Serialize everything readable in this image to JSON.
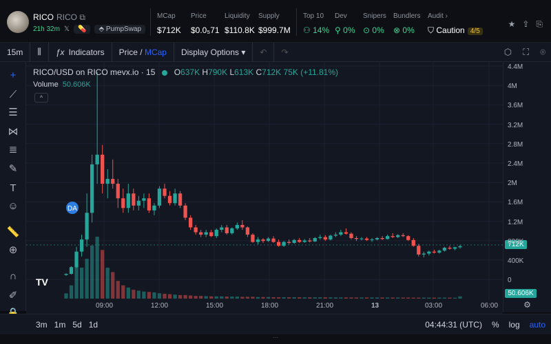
{
  "token": {
    "name": "RICO",
    "symbol": "RICO",
    "age": "21h 32m",
    "dex": "PumpSwap"
  },
  "stats": [
    {
      "label": "MCap",
      "value": "$712K"
    },
    {
      "label": "Price",
      "value": "$0.0₅71"
    },
    {
      "label": "Liquidity",
      "value": "$110.8K"
    },
    {
      "label": "Supply",
      "value": "$999.7M"
    }
  ],
  "holders": [
    {
      "label": "Top 10",
      "value": "14%"
    },
    {
      "label": "Dev",
      "value": "0%"
    },
    {
      "label": "Snipers",
      "value": "0%"
    },
    {
      "label": "Bundlers",
      "value": "0%"
    }
  ],
  "audit": {
    "label": "Audit",
    "value": "Caution",
    "score": "4/5"
  },
  "toolbar": {
    "interval": "15m",
    "indicators": "Indicators",
    "price": "Price",
    "mcap": "MCap",
    "display": "Display Options"
  },
  "legend": {
    "pair": "RICO/USD on RICO mevx.io · 15",
    "o": "637K",
    "h": "790K",
    "l": "613K",
    "c": "712K",
    "change": "75K (+11.81%)",
    "volume_label": "Volume",
    "volume_value": "50.606K"
  },
  "yaxis": [
    "4.4M",
    "4M",
    "3.6M",
    "3.2M",
    "2.8M",
    "2.4M",
    "2M",
    "1.6M",
    "1.2M",
    "800K",
    "400K",
    "0"
  ],
  "price_tag": "712K",
  "volume_tag": "50.606K",
  "xaxis": [
    "09:00",
    "12:00",
    "15:00",
    "18:00",
    "21:00",
    "13",
    "03:00",
    "06:00"
  ],
  "ranges": [
    "3m",
    "1m",
    "5d",
    "1d"
  ],
  "clock": "04:44:31 (UTC)",
  "bottom_right": {
    "pct": "%",
    "log": "log",
    "auto": "auto"
  },
  "marker": "DA",
  "colors": {
    "up": "#26a69a",
    "down": "#ef5350",
    "accent": "#2962ff"
  },
  "chart_data": {
    "type": "candlestick",
    "ylim": [
      0,
      4400000
    ],
    "candles": [
      [
        120,
        150,
        100,
        140
      ],
      [
        140,
        300,
        130,
        280
      ],
      [
        280,
        700,
        260,
        600
      ],
      [
        600,
        950,
        500,
        850
      ],
      [
        850,
        1800,
        700,
        1400
      ],
      [
        1400,
        2600,
        1200,
        2400
      ],
      [
        2400,
        4300,
        2000,
        2600
      ],
      [
        2600,
        2800,
        1800,
        2000
      ],
      [
        2000,
        2300,
        1700,
        2100
      ],
      [
        2100,
        2500,
        1900,
        2000
      ],
      [
        2000,
        2100,
        1500,
        1700
      ],
      [
        1700,
        1900,
        1400,
        1500
      ],
      [
        1500,
        2000,
        1400,
        1800
      ],
      [
        1800,
        1900,
        1450,
        1550
      ],
      [
        1550,
        1750,
        1450,
        1650
      ],
      [
        1650,
        1800,
        1500,
        1700
      ],
      [
        1700,
        1800,
        1400,
        1450
      ],
      [
        1450,
        1600,
        1350,
        1550
      ],
      [
        1550,
        1950,
        1500,
        1900
      ],
      [
        1900,
        2000,
        1700,
        1750
      ],
      [
        1750,
        1850,
        1550,
        1600
      ],
      [
        1600,
        1900,
        1550,
        1800
      ],
      [
        1800,
        1850,
        1500,
        1550
      ],
      [
        1550,
        1600,
        1250,
        1300
      ],
      [
        1300,
        1350,
        1050,
        1100
      ],
      [
        1100,
        1150,
        950,
        1000
      ],
      [
        1000,
        1050,
        900,
        950
      ],
      [
        950,
        1050,
        900,
        1000
      ],
      [
        1000,
        1050,
        900,
        920
      ],
      [
        920,
        1080,
        880,
        1050
      ],
      [
        1050,
        1150,
        1000,
        1100
      ],
      [
        1100,
        1150,
        950,
        980
      ],
      [
        980,
        1100,
        950,
        1080
      ],
      [
        1080,
        1200,
        1050,
        1150
      ],
      [
        1150,
        1250,
        1050,
        1100
      ],
      [
        1100,
        1120,
        900,
        950
      ],
      [
        950,
        980,
        780,
        800
      ],
      [
        800,
        900,
        750,
        850
      ],
      [
        850,
        880,
        780,
        820
      ],
      [
        820,
        900,
        800,
        870
      ],
      [
        870,
        920,
        780,
        800
      ],
      [
        800,
        850,
        700,
        720
      ],
      [
        720,
        820,
        700,
        800
      ],
      [
        800,
        850,
        750,
        780
      ],
      [
        780,
        860,
        760,
        840
      ],
      [
        840,
        880,
        780,
        800
      ],
      [
        800,
        860,
        780,
        830
      ],
      [
        830,
        880,
        790,
        810
      ],
      [
        810,
        900,
        800,
        880
      ],
      [
        880,
        950,
        850,
        900
      ],
      [
        900,
        940,
        820,
        850
      ],
      [
        850,
        950,
        830,
        930
      ],
      [
        930,
        1000,
        900,
        950
      ],
      [
        950,
        1050,
        920,
        1000
      ],
      [
        1000,
        1080,
        950,
        970
      ],
      [
        970,
        1000,
        850,
        880
      ],
      [
        880,
        920,
        820,
        860
      ],
      [
        860,
        900,
        830,
        870
      ],
      [
        870,
        900,
        820,
        840
      ],
      [
        840,
        880,
        800,
        850
      ],
      [
        850,
        900,
        830,
        880
      ],
      [
        880,
        920,
        840,
        860
      ],
      [
        860,
        950,
        850,
        920
      ],
      [
        920,
        980,
        880,
        900
      ],
      [
        900,
        960,
        880,
        940
      ],
      [
        940,
        980,
        900,
        920
      ],
      [
        920,
        940,
        820,
        840
      ],
      [
        840,
        880,
        700,
        720
      ],
      [
        720,
        760,
        500,
        540
      ],
      [
        540,
        600,
        480,
        560
      ],
      [
        560,
        620,
        520,
        600
      ],
      [
        600,
        640,
        560,
        580
      ],
      [
        580,
        640,
        560,
        620
      ],
      [
        620,
        700,
        600,
        680
      ],
      [
        680,
        720,
        640,
        660
      ],
      [
        660,
        700,
        630,
        690
      ],
      [
        690,
        740,
        660,
        712
      ]
    ],
    "volume": [
      120,
      300,
      800,
      700,
      900,
      1200,
      1400,
      1100,
      700,
      600,
      400,
      300,
      250,
      200,
      180,
      160,
      150,
      140,
      120,
      110,
      100,
      90,
      80,
      80,
      70,
      60,
      60,
      55,
      50,
      50,
      50,
      45,
      45,
      45,
      40,
      40,
      40,
      35,
      35,
      35,
      30,
      30,
      30,
      30,
      30,
      30,
      28,
      28,
      28,
      28,
      28,
      28,
      26,
      26,
      26,
      26,
      25,
      25,
      25,
      25,
      25,
      25,
      24,
      24,
      24,
      24,
      24,
      22,
      22,
      22,
      22,
      22,
      22,
      22,
      22,
      20,
      50
    ]
  }
}
